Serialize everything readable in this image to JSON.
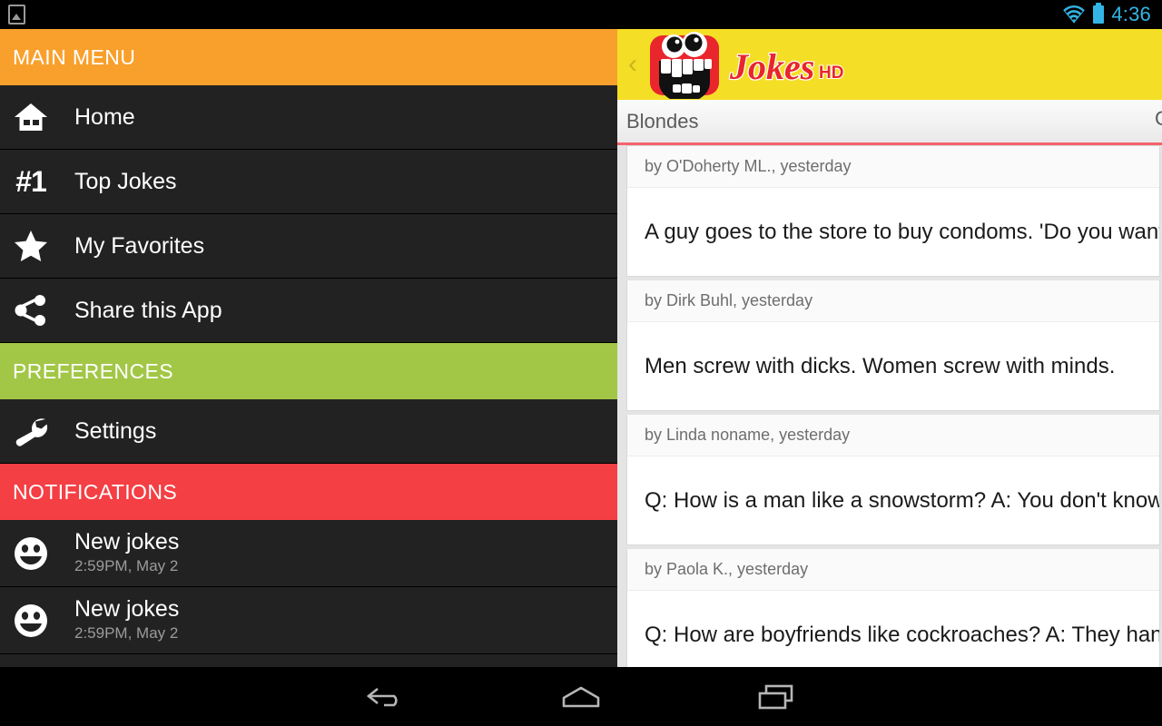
{
  "statusbar": {
    "notification_icon": "image-notification-icon",
    "wifi_icon": "wifi-icon",
    "battery_icon": "battery-icon",
    "clock": "4:36"
  },
  "drawer": {
    "sections": [
      {
        "title": "MAIN MENU",
        "color": "#f9a02c"
      },
      {
        "title": "PREFERENCES",
        "color": "#a2c746"
      },
      {
        "title": "NOTIFICATIONS",
        "color": "#f43f44"
      }
    ],
    "main_menu": [
      {
        "label": "Home",
        "icon": "home-icon"
      },
      {
        "label": "Top Jokes",
        "icon": "number-one-icon",
        "icon_text": "#1"
      },
      {
        "label": "My Favorites",
        "icon": "star-icon"
      },
      {
        "label": "Share this App",
        "icon": "share-icon"
      }
    ],
    "preferences": [
      {
        "label": "Settings",
        "icon": "wrench-icon"
      }
    ],
    "notifications": [
      {
        "title": "New jokes",
        "time": "2:59PM, May 2",
        "icon": "smiley-icon"
      },
      {
        "title": "New jokes",
        "time": "2:59PM, May 2",
        "icon": "smiley-icon"
      }
    ]
  },
  "app": {
    "back_chevron": "‹",
    "logo": {
      "name": "jokes-hd-logo",
      "wordmark": "Jokes",
      "badge": "HD"
    },
    "tabs": [
      {
        "label": "Blondes",
        "active": true
      },
      {
        "label": "C",
        "active": false
      }
    ],
    "accent_color": "#f4646b",
    "appbar_color": "#f5de26",
    "jokes": [
      {
        "meta": "by O'Doherty ML., yesterday",
        "text": "A guy goes to the store to buy condoms. 'Do you want a bag?'"
      },
      {
        "meta": "by Dirk Buhl, yesterday",
        "text": "Men screw with dicks. Women screw with minds."
      },
      {
        "meta": "by Linda noname, yesterday",
        "text": "Q: How is a man like a snowstorm? A: You don't know when he"
      },
      {
        "meta": "by Paola K., yesterday",
        "text": "Q: How are boyfriends like cockroaches? A: They hang around"
      }
    ]
  },
  "navbar": {
    "back": "back-icon",
    "home": "home-icon",
    "recent": "recent-apps-icon"
  }
}
